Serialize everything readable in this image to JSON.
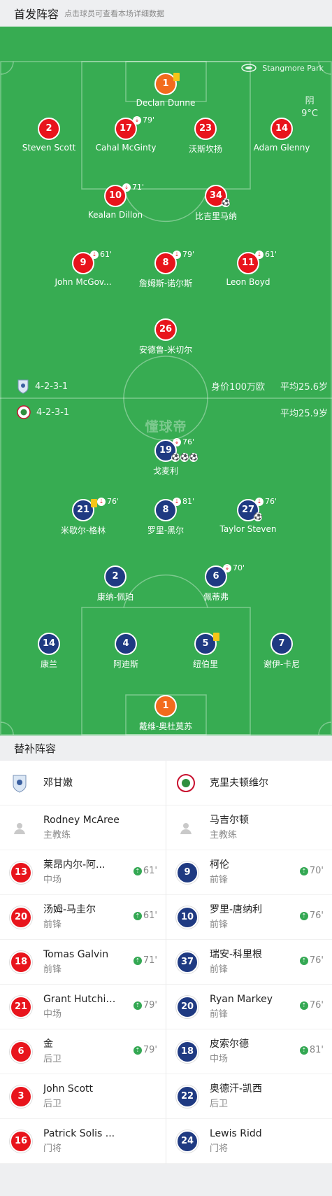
{
  "header": {
    "title": "首发阵容",
    "subtitle": "点击球员可查看本场详细数据"
  },
  "venue": {
    "name": "Stangmore Park",
    "icon": "stadium-icon"
  },
  "weather": {
    "condition": "阴",
    "temp": "9°C"
  },
  "watermark": "懂球帝",
  "home_summary": {
    "formation": "4-2-3-1",
    "value": "身价100万欧",
    "avg_age": "平均25.6岁"
  },
  "away_summary": {
    "formation": "4-2-3-1",
    "avg_age": "平均25.9岁"
  },
  "home_players": [
    {
      "num": "1",
      "name": "Declan Dunne",
      "color": "orange",
      "card": "yellow"
    },
    {
      "num": "2",
      "name": "Steven Scott",
      "color": "red"
    },
    {
      "num": "17",
      "name": "Cahal McGinty",
      "color": "red",
      "sub_min": "79'"
    },
    {
      "num": "23",
      "name": "沃斯坎扬",
      "color": "red"
    },
    {
      "num": "14",
      "name": "Adam Glenny",
      "color": "red"
    },
    {
      "num": "10",
      "name": "Kealan Dillon",
      "color": "red",
      "sub_min": "71'"
    },
    {
      "num": "34",
      "name": "比吉里马纳",
      "color": "red",
      "goals": 1
    },
    {
      "num": "9",
      "name": "John McGov...",
      "color": "red",
      "sub_min": "61'"
    },
    {
      "num": "8",
      "name": "詹姆斯-诺尔斯",
      "color": "red",
      "sub_min": "79'"
    },
    {
      "num": "11",
      "name": "Leon Boyd",
      "color": "red",
      "sub_min": "61'"
    },
    {
      "num": "26",
      "name": "安德鲁-米切尔",
      "color": "red"
    }
  ],
  "away_players": [
    {
      "num": "19",
      "name": "戈麦利",
      "color": "navy",
      "sub_min": "76'",
      "goals": 3
    },
    {
      "num": "21",
      "name": "米歇尔-格林",
      "color": "navy",
      "sub_min": "76'",
      "card": "yellow"
    },
    {
      "num": "8",
      "name": "罗里-黑尔",
      "color": "navy",
      "sub_min": "81'"
    },
    {
      "num": "27",
      "name": "Taylor Steven",
      "color": "navy",
      "sub_min": "76'",
      "goals": 1
    },
    {
      "num": "2",
      "name": "康纳-佩珀",
      "color": "navy"
    },
    {
      "num": "6",
      "name": "佩蒂弗",
      "color": "navy",
      "sub_min": "70'"
    },
    {
      "num": "14",
      "name": "康兰",
      "color": "navy"
    },
    {
      "num": "4",
      "name": "阿迪斯",
      "color": "navy"
    },
    {
      "num": "5",
      "name": "纽伯里",
      "color": "navy",
      "card": "yellow"
    },
    {
      "num": "7",
      "name": "谢伊-卡尼",
      "color": "navy"
    },
    {
      "num": "1",
      "name": "戴维-奥杜莫苏",
      "color": "orange"
    }
  ],
  "bench_header": "替补阵容",
  "bench": {
    "home_team": "邓甘嫩",
    "away_team": "克里夫顿维尔",
    "home_coach": {
      "name": "Rodney McAree",
      "role": "主教练"
    },
    "away_coach": {
      "name": "马吉尔顿",
      "role": "主教练"
    },
    "rows": [
      [
        {
          "num": "13",
          "name": "莱昂内尔-阿...",
          "pos": "中场",
          "time": "61'"
        },
        {
          "num": "9",
          "name": "柯伦",
          "pos": "前锋",
          "time": "70'"
        }
      ],
      [
        {
          "num": "20",
          "name": "汤姆-马圭尔",
          "pos": "前锋",
          "time": "61'"
        },
        {
          "num": "10",
          "name": "罗里-唐纳利",
          "pos": "前锋",
          "time": "76'"
        }
      ],
      [
        {
          "num": "18",
          "name": "Tomas Galvin",
          "pos": "前锋",
          "time": "71'"
        },
        {
          "num": "37",
          "name": "瑞安-科里根",
          "pos": "前锋",
          "time": "76'"
        }
      ],
      [
        {
          "num": "21",
          "name": "Grant Hutchin...",
          "pos": "中场",
          "time": "79'"
        },
        {
          "num": "20",
          "name": "Ryan Markey",
          "pos": "前锋",
          "time": "76'"
        }
      ],
      [
        {
          "num": "6",
          "name": "金",
          "pos": "后卫",
          "time": "79'"
        },
        {
          "num": "18",
          "name": "皮索尔德",
          "pos": "中场",
          "time": "81'"
        }
      ],
      [
        {
          "num": "3",
          "name": "John Scott",
          "pos": "后卫"
        },
        {
          "num": "22",
          "name": "奥德汗-凯西",
          "pos": "后卫"
        }
      ],
      [
        {
          "num": "16",
          "name": "Patrick Solis ...",
          "pos": "门将"
        },
        {
          "num": "24",
          "name": "Lewis Ridd",
          "pos": "门将"
        }
      ]
    ]
  },
  "colors": {
    "pitch": "#37ac52",
    "home": "#e8141c",
    "away": "#1f3a82",
    "gk": "#f26b1d",
    "yellow_card": "#f5c518",
    "sub_in": "#34a853"
  }
}
